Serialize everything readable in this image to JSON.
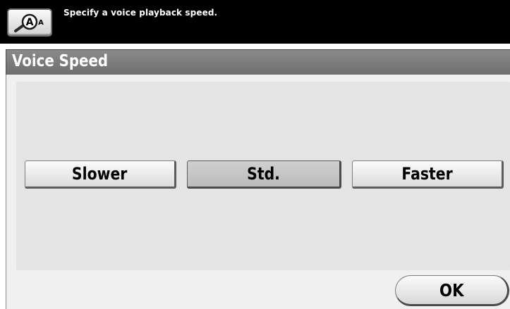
{
  "header": {
    "message": "Specify a voice playback speed.",
    "accessibility_icon": "accessibility-icon"
  },
  "window": {
    "title": "Voice Speed"
  },
  "speed_options": [
    {
      "label": "Slower",
      "selected": false
    },
    {
      "label": "Std.",
      "selected": true
    },
    {
      "label": "Faster",
      "selected": false
    }
  ],
  "footer": {
    "ok_label": "OK"
  },
  "colors": {
    "topbar": "#000000",
    "titlebar": "#7a7a7a",
    "panel": "#e4e4e4",
    "selected_button": "#c6c6c6"
  }
}
